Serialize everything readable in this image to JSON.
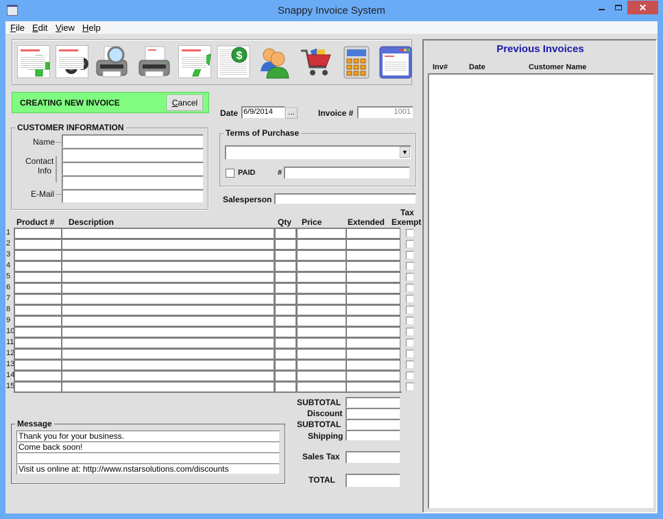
{
  "window": {
    "title": "Snappy Invoice System",
    "minimize_icon": "minimize-icon",
    "maximize_icon": "maximize-icon",
    "close_glyph": "✕"
  },
  "menu": [
    {
      "label": "File",
      "mnemonic": "F",
      "rest": "ile"
    },
    {
      "label": "Edit",
      "mnemonic": "E",
      "rest": "dit"
    },
    {
      "label": "View",
      "mnemonic": "V",
      "rest": "iew"
    },
    {
      "label": "Help",
      "mnemonic": "H",
      "rest": "elp"
    }
  ],
  "toolbar": [
    {
      "name": "new-invoice",
      "icon": "document-plus-icon"
    },
    {
      "name": "find-invoices",
      "icon": "binoculars-icon"
    },
    {
      "name": "print-preview",
      "icon": "printer-magnifier-icon"
    },
    {
      "name": "print",
      "icon": "printer-icon"
    },
    {
      "name": "export-invoice",
      "icon": "document-arrow-up-icon"
    },
    {
      "name": "payments-report",
      "icon": "dollar-report-icon"
    },
    {
      "name": "customers",
      "icon": "people-icon"
    },
    {
      "name": "products",
      "icon": "shopping-cart-icon"
    },
    {
      "name": "calculator",
      "icon": "calculator-icon"
    },
    {
      "name": "invoice-settings",
      "icon": "window-document-icon"
    }
  ],
  "status_banner": {
    "text": "CREATING NEW INVOICE",
    "color": "#80fc80",
    "cancel_label": "Cancel",
    "cancel_mnemonic": "C",
    "cancel_rest": "ancel"
  },
  "customer": {
    "legend": "CUSTOMER INFORMATION",
    "name_label": "Name",
    "contact_label_1": "Contact",
    "contact_label_2": "Info",
    "email_label": "E-Mail",
    "name": "",
    "contact": [
      "",
      "",
      ""
    ],
    "email": ""
  },
  "invoice": {
    "date_label": "Date",
    "date": "6/9/2014",
    "date_picker_label": "...",
    "number_label": "Invoice #",
    "number": "1001"
  },
  "terms": {
    "legend": "Terms of Purchase",
    "selected": "",
    "paid_label": "PAID",
    "paid": false,
    "check_no_label": "#",
    "check_no": ""
  },
  "salesperson": {
    "label": "Salesperson",
    "value": ""
  },
  "items": {
    "headers": {
      "product": "Product #",
      "description": "Description",
      "qty": "Qty",
      "price": "Price",
      "extended": "Extended",
      "tax_exempt_1": "Tax",
      "tax_exempt_2": "Exempt"
    },
    "rows": [
      "1",
      "2",
      "3",
      "4",
      "5",
      "6",
      "7",
      "8",
      "9",
      "10",
      "11",
      "12",
      "13",
      "14",
      "15"
    ]
  },
  "totals": {
    "subtotal_label": "SUBTOTAL",
    "discount_label": "Discount",
    "subtotal2_label": "SUBTOTAL",
    "shipping_label": "Shipping",
    "sales_tax_label": "Sales Tax",
    "total_label": "TOTAL",
    "subtotal": "",
    "discount": "",
    "subtotal2": "",
    "shipping": "",
    "sales_tax": "",
    "total": ""
  },
  "message": {
    "legend": "Message",
    "lines": [
      "Thank you for your business.",
      "Come back soon!",
      "",
      "Visit us online at: http://www.nstarsolutions.com/discounts"
    ]
  },
  "previous_invoices": {
    "title": "Previous Invoices",
    "title_color": "#1a1aa6",
    "columns": [
      "Inv#",
      "Date",
      "Customer Name"
    ],
    "rows": []
  }
}
